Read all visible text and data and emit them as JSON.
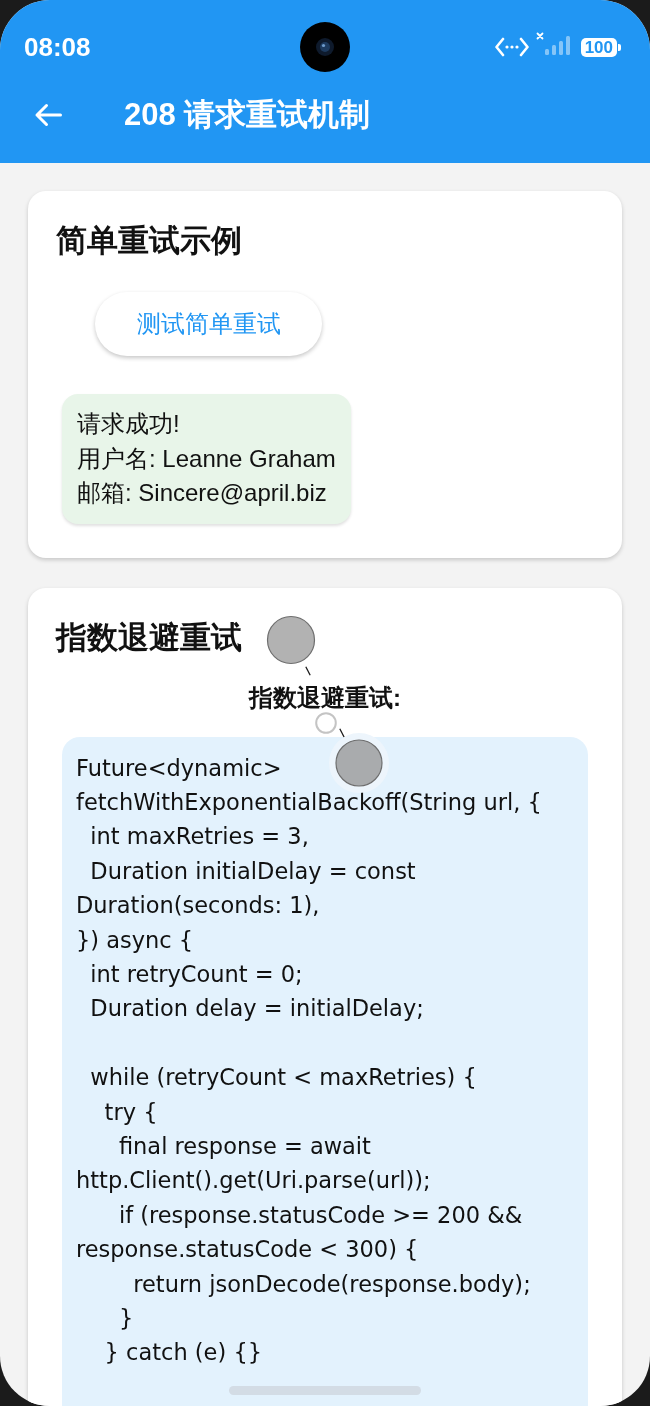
{
  "status_bar": {
    "time": "08:08",
    "battery": "100"
  },
  "app_bar": {
    "title": "208 请求重试机制"
  },
  "cards": [
    {
      "kind": "simple",
      "title": "简单重试示例",
      "button": "测试简单重试",
      "result": "请求成功!\n用户名: Leanne Graham\n邮箱: Sincere@april.biz"
    },
    {
      "kind": "code",
      "title": "指数退避重试",
      "label": "指数退避重试:",
      "code": "Future<dynamic>\nfetchWithExponentialBackoff(String url, {\n  int maxRetries = 3,\n  Duration initialDelay = const\nDuration(seconds: 1),\n}) async {\n  int retryCount = 0;\n  Duration delay = initialDelay;\n\n  while (retryCount < maxRetries) {\n    try {\n      final response = await\nhttp.Client().get(Uri.parse(url));\n      if (response.statusCode >= 200 &&\nresponse.statusCode < 300) {\n        return jsonDecode(response.body);\n      }\n    } catch (e) {}"
    }
  ]
}
